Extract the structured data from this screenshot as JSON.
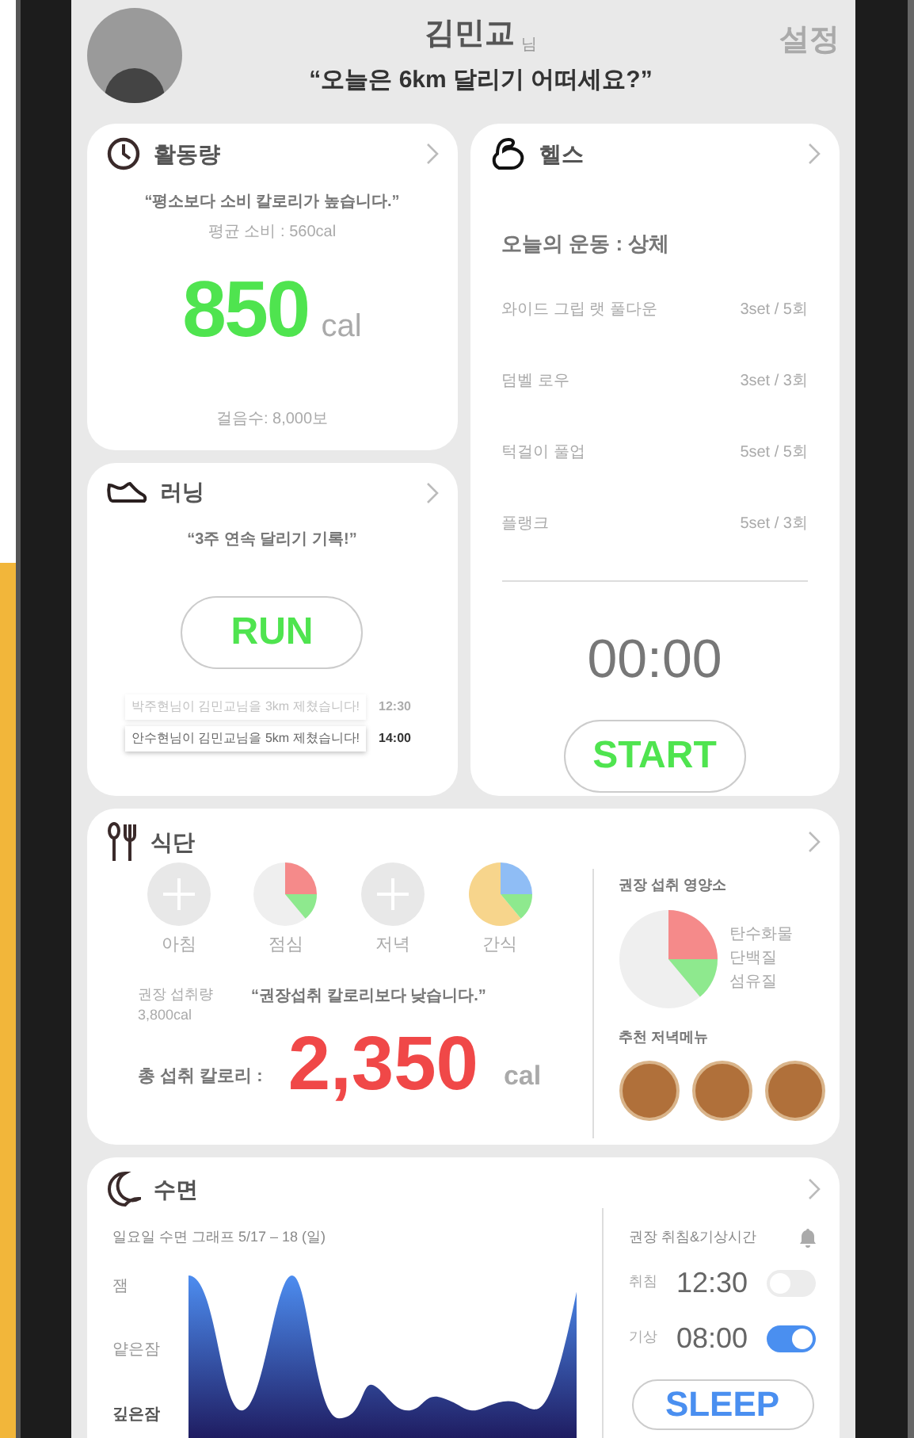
{
  "header": {
    "name": "김민교",
    "honorific": "님",
    "message": "“오늘은 6km 달리기 어떠세요?”",
    "settings": "설정"
  },
  "activity": {
    "title": "활동량",
    "quote": "“평소보다 소비 칼로리가 높습니다.”",
    "average": "평균 소비 : 560cal",
    "value": "850",
    "unit": "cal",
    "steps": "걸음수: 8,000보"
  },
  "running": {
    "title": "러닝",
    "quote": "“3주 연속 달리기 기록!”",
    "button": "RUN",
    "messages": [
      {
        "text": "박주현님이 김민교님을 3km 제쳤습니다!",
        "time": "12:30",
        "dimmed": true
      },
      {
        "text": "안수현님이 김민교님을 5km 제쳤습니다!",
        "time": "14:00",
        "dimmed": false
      }
    ]
  },
  "health": {
    "title": "헬스",
    "today": "오늘의 운동 : 상체",
    "exercises": [
      {
        "name": "와이드 그립 랫 풀다운",
        "sets": "3set / 5회"
      },
      {
        "name": "덤벨 로우",
        "sets": "3set / 3회"
      },
      {
        "name": "턱걸이 풀업",
        "sets": "5set / 5회"
      },
      {
        "name": "플랭크",
        "sets": "5set / 3회"
      }
    ],
    "timer": "00:00",
    "button": "START"
  },
  "diet": {
    "title": "식단",
    "meals": [
      {
        "label": "아침",
        "kind": "plus"
      },
      {
        "label": "점심",
        "kind": "partial"
      },
      {
        "label": "저녁",
        "kind": "plus"
      },
      {
        "label": "간식",
        "kind": "full"
      }
    ],
    "recommended_label": "권장 섭취량",
    "recommended_value": "3,800cal",
    "quote": "“권장섭취 칼로리보다 낮습니다.”",
    "total_label": "총 섭취 칼로리 :",
    "total": "2,350",
    "unit": "cal",
    "nutrients_title": "권장 섭취 영양소",
    "nutrients": [
      "탄수화물",
      "단백질",
      "섬유질"
    ],
    "menu_title": "추천 저녁메뉴",
    "menus": [
      {
        "kind": "photo"
      },
      {
        "kind": "photo"
      },
      {
        "kind": "photo"
      }
    ]
  },
  "sleep": {
    "title": "수면",
    "graph_title": "일요일 수면 그래프 5/17 – 18 (일)",
    "levels": [
      "잼",
      "얕은잠",
      "깊은잠"
    ],
    "alarm_title": "권장 취침&기상시간",
    "alarms": [
      {
        "label": "취침",
        "time": "12:30",
        "on": false
      },
      {
        "label": "기상",
        "time": "08:00",
        "on": true
      }
    ],
    "button": "SLEEP"
  }
}
